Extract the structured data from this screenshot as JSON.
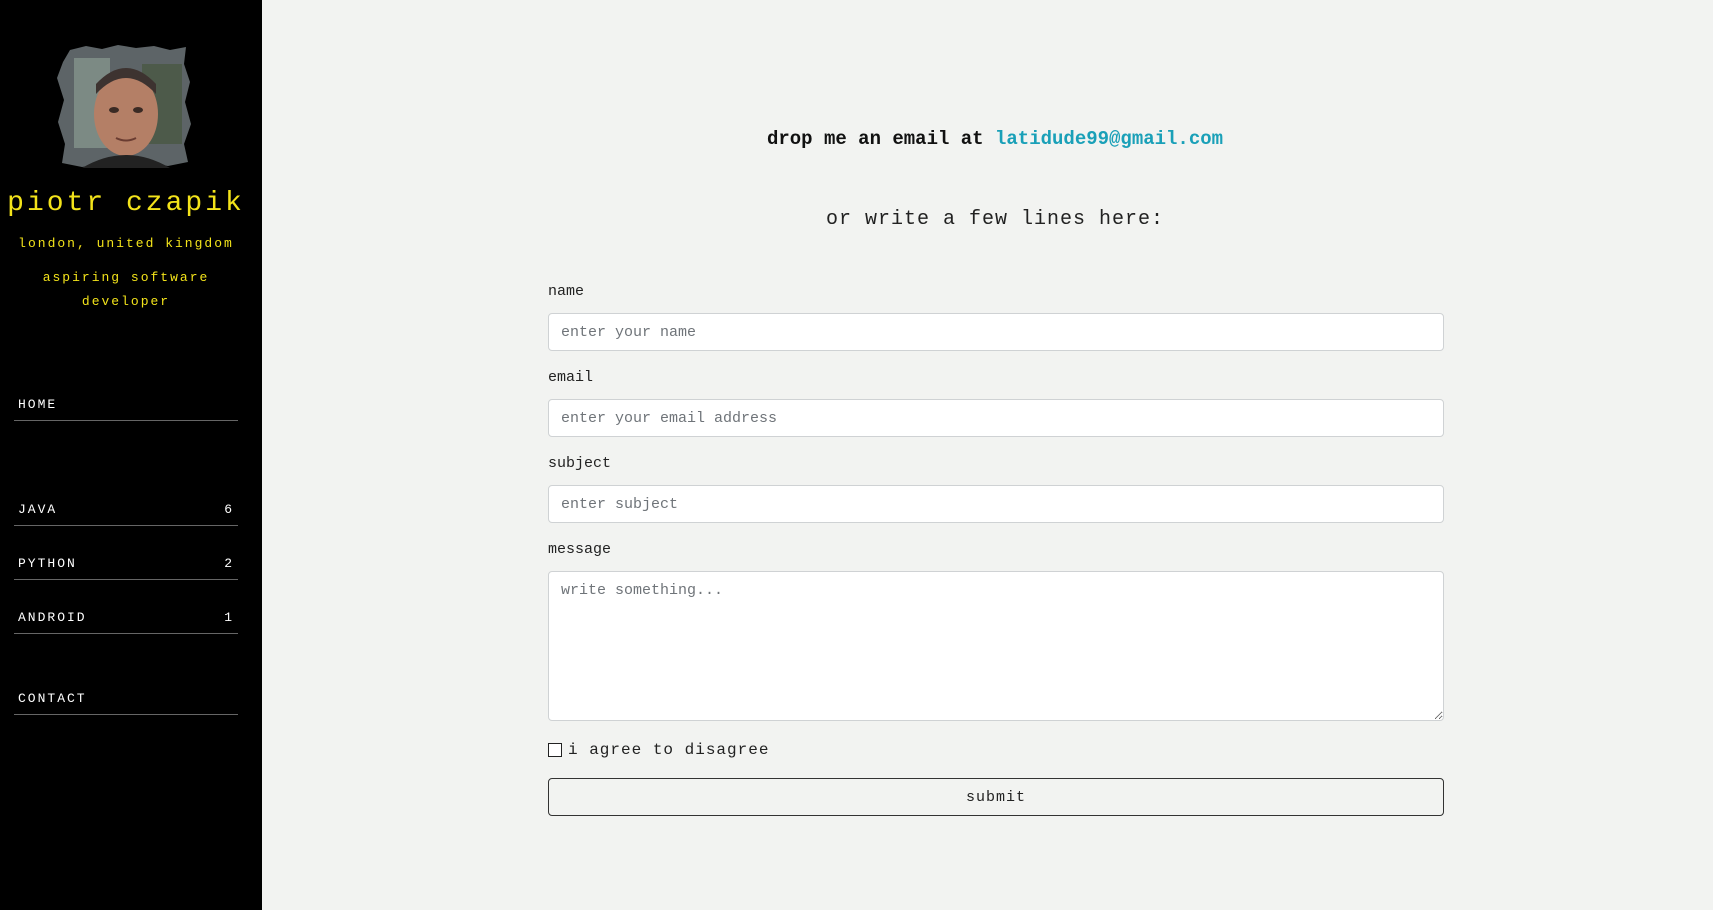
{
  "profile": {
    "name": "piotr czapik",
    "location": "london, united kingdom",
    "role": "aspiring software developer",
    "avatar_icon": "profile-photo"
  },
  "nav": {
    "home": {
      "label": "HOME"
    },
    "categories": [
      {
        "label": "JAVA",
        "count": "6"
      },
      {
        "label": "PYTHON",
        "count": "2"
      },
      {
        "label": "ANDROID",
        "count": "1"
      }
    ],
    "contact": {
      "label": "CONTACT"
    }
  },
  "contact": {
    "email_prefix": "drop me an email at ",
    "email": "latidude99@gmail.com",
    "subheading": "or write a few lines here:"
  },
  "form": {
    "name_label": "name",
    "name_placeholder": "enter your name",
    "email_label": "email",
    "email_placeholder": "enter your email address",
    "subject_label": "subject",
    "subject_placeholder": "enter subject",
    "message_label": "message",
    "message_placeholder": "write something...",
    "checkbox_label": "i agree to disagree",
    "submit_label": "submit"
  },
  "colors": {
    "sidebar_bg": "#000000",
    "sidebar_accent": "#f3e31a",
    "link": "#1aa0b8",
    "page_bg": "#f2f3f1"
  }
}
